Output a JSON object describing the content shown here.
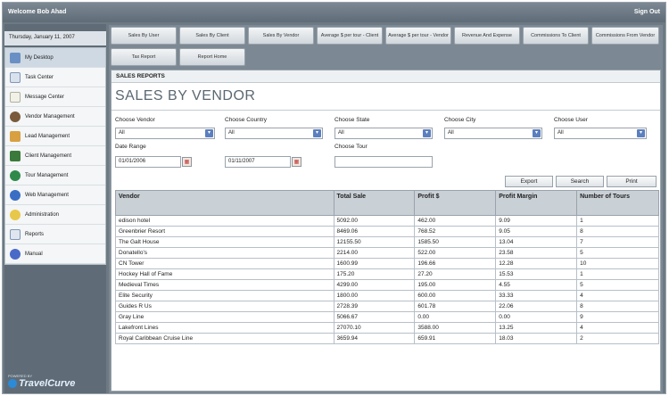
{
  "header": {
    "welcome": "Welcome Bob Ahad",
    "signout": "Sign Out"
  },
  "sidebar": {
    "date": "Thursday, January 11, 2007",
    "items": [
      {
        "label": "My Desktop",
        "icon": "desktop-icon"
      },
      {
        "label": "Task Center",
        "icon": "task-icon"
      },
      {
        "label": "Message Center",
        "icon": "message-icon"
      },
      {
        "label": "Vendor Management",
        "icon": "vendor-icon"
      },
      {
        "label": "Lead Management",
        "icon": "lead-icon"
      },
      {
        "label": "Client Management",
        "icon": "client-icon"
      },
      {
        "label": "Tour Management",
        "icon": "globe-icon"
      },
      {
        "label": "Web Management",
        "icon": "web-icon"
      },
      {
        "label": "Administration",
        "icon": "admin-icon"
      },
      {
        "label": "Reports",
        "icon": "reports-icon"
      },
      {
        "label": "Manual",
        "icon": "manual-icon"
      }
    ],
    "logo_small": "POWERED BY",
    "logo": "TravelCurve"
  },
  "tabs": [
    "Sales By User",
    "Sales By Client",
    "Sales By Vendor",
    "Average $ per tour - Client",
    "Average $ per tour - Vendor",
    "Revenue And Expense",
    "Commissions To Client",
    "Commissions From Vendor",
    "Tax Report",
    "Report Home"
  ],
  "panel": {
    "heading": "SALES REPORTS",
    "title": "SALES BY VENDOR",
    "filters": {
      "vendor_label": "Choose Vendor",
      "vendor_value": "All",
      "country_label": "Choose Country",
      "country_value": "All",
      "state_label": "Choose State",
      "state_value": "All",
      "city_label": "Choose City",
      "city_value": "All",
      "user_label": "Choose User",
      "user_value": "All",
      "date_label": "Date Range",
      "date_from": "01/01/2006",
      "date_to": "01/11/2007",
      "tour_label": "Choose Tour",
      "tour_value": ""
    },
    "buttons": {
      "export": "Export",
      "search": "Search",
      "print": "Print"
    }
  },
  "table": {
    "headers": [
      "Vendor",
      "Total Sale",
      "Profit $",
      "Profit Margin",
      "Number of Tours"
    ],
    "rows": [
      [
        "edison hotel",
        "5092.00",
        "462.00",
        "9.09",
        "1"
      ],
      [
        "Greenbrier Resort",
        "8469.06",
        "768.52",
        "9.05",
        "8"
      ],
      [
        "The Galt House",
        "12155.50",
        "1585.50",
        "13.04",
        "7"
      ],
      [
        "Donatello's",
        "2214.00",
        "522.00",
        "23.58",
        "5"
      ],
      [
        "CN Tower",
        "1600.99",
        "196.66",
        "12.28",
        "10"
      ],
      [
        "Hockey Hall of Fame",
        "175.20",
        "27.20",
        "15.53",
        "1"
      ],
      [
        "Medieval Times",
        "4299.00",
        "195.00",
        "4.55",
        "5"
      ],
      [
        "Elite Security",
        "1800.00",
        "600.00",
        "33.33",
        "4"
      ],
      [
        "Guides R Us",
        "2728.39",
        "601.78",
        "22.06",
        "8"
      ],
      [
        "Gray Line",
        "5066.67",
        "0.00",
        "0.00",
        "9"
      ],
      [
        "Lakefront Lines",
        "27070.10",
        "3588.00",
        "13.25",
        "4"
      ],
      [
        "Royal Caribbean Cruise Line",
        "3659.94",
        "659.91",
        "18.03",
        "2"
      ]
    ]
  },
  "colors": {
    "chrome": "#6d7a84",
    "header_bg": "#c9d0d6",
    "select_arrow": "#5b7fbf"
  }
}
